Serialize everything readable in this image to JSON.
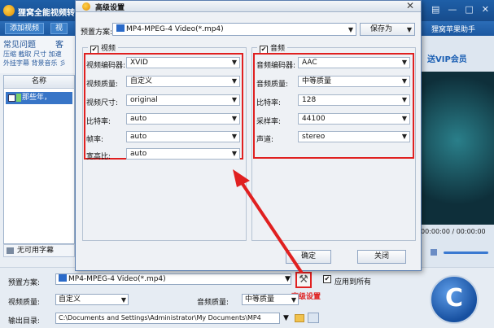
{
  "app": {
    "title": "狸窝全能视频转",
    "toolbar": {
      "add_video": "添加视频",
      "video_tab": "视",
      "assistant": "狸窝苹果助手"
    },
    "menu": {
      "faq": "常见问题",
      "faq_right": "客",
      "row1": "压缩 截取 尺寸 加速",
      "row2": "外挂字幕 背景音乐 彡"
    },
    "file_list": {
      "header": "名称",
      "row_name": "那些年，"
    },
    "subtitle": "无可用字幕",
    "vip": "送VIP会员",
    "time": "00:00:00 / 00:00:00",
    "window_controls": {
      "min": "—",
      "max": "□",
      "close": "✕",
      "menu": "▤"
    }
  },
  "bottom": {
    "preset_label": "预置方案:",
    "preset_value": "MP4-MPEG-4 Video(*.mp4)",
    "apply_all": "应用到所有",
    "apply_all_checked": "✔",
    "video_quality_label": "视频质量:",
    "video_quality_value": "自定义",
    "audio_quality_label": "音频质量:",
    "audio_quality_value": "中等质量",
    "output_label": "输出目录:",
    "output_value": "C:\\Documents and Settings\\Administrator\\My Documents\\MP4",
    "advanced_label": "高级设置",
    "gear_glyph": "⚒",
    "convert_glyph": "C"
  },
  "dialog": {
    "title": "高级设置",
    "close": "✕",
    "preset_label": "预置方案:",
    "preset_value": "MP4-MPEG-4 Video(*.mp4)",
    "save_as": "保存为",
    "video_group": {
      "title": "视频",
      "checked": "✔",
      "fields": [
        {
          "label": "视频编码器:",
          "value": "XVID"
        },
        {
          "label": "视频质量:",
          "value": "自定义"
        },
        {
          "label": "视频尺寸:",
          "value": "original"
        },
        {
          "label": "比特率:",
          "value": "auto"
        },
        {
          "label": "帧率:",
          "value": "auto"
        },
        {
          "label": "宽高比:",
          "value": "auto"
        }
      ]
    },
    "audio_group": {
      "title": "音频",
      "checked": "✔",
      "fields": [
        {
          "label": "音频编码器:",
          "value": "AAC"
        },
        {
          "label": "音频质量:",
          "value": "中等质量"
        },
        {
          "label": "比特率:",
          "value": "128"
        },
        {
          "label": "采样率:",
          "value": "44100"
        },
        {
          "label": "声道:",
          "value": "stereo"
        }
      ]
    },
    "ok": "确定",
    "close_button": "关闭"
  },
  "dropdown_glyph": "▼",
  "colors": {
    "highlight": "#e02020",
    "title_blue": "#1e5fa8"
  }
}
